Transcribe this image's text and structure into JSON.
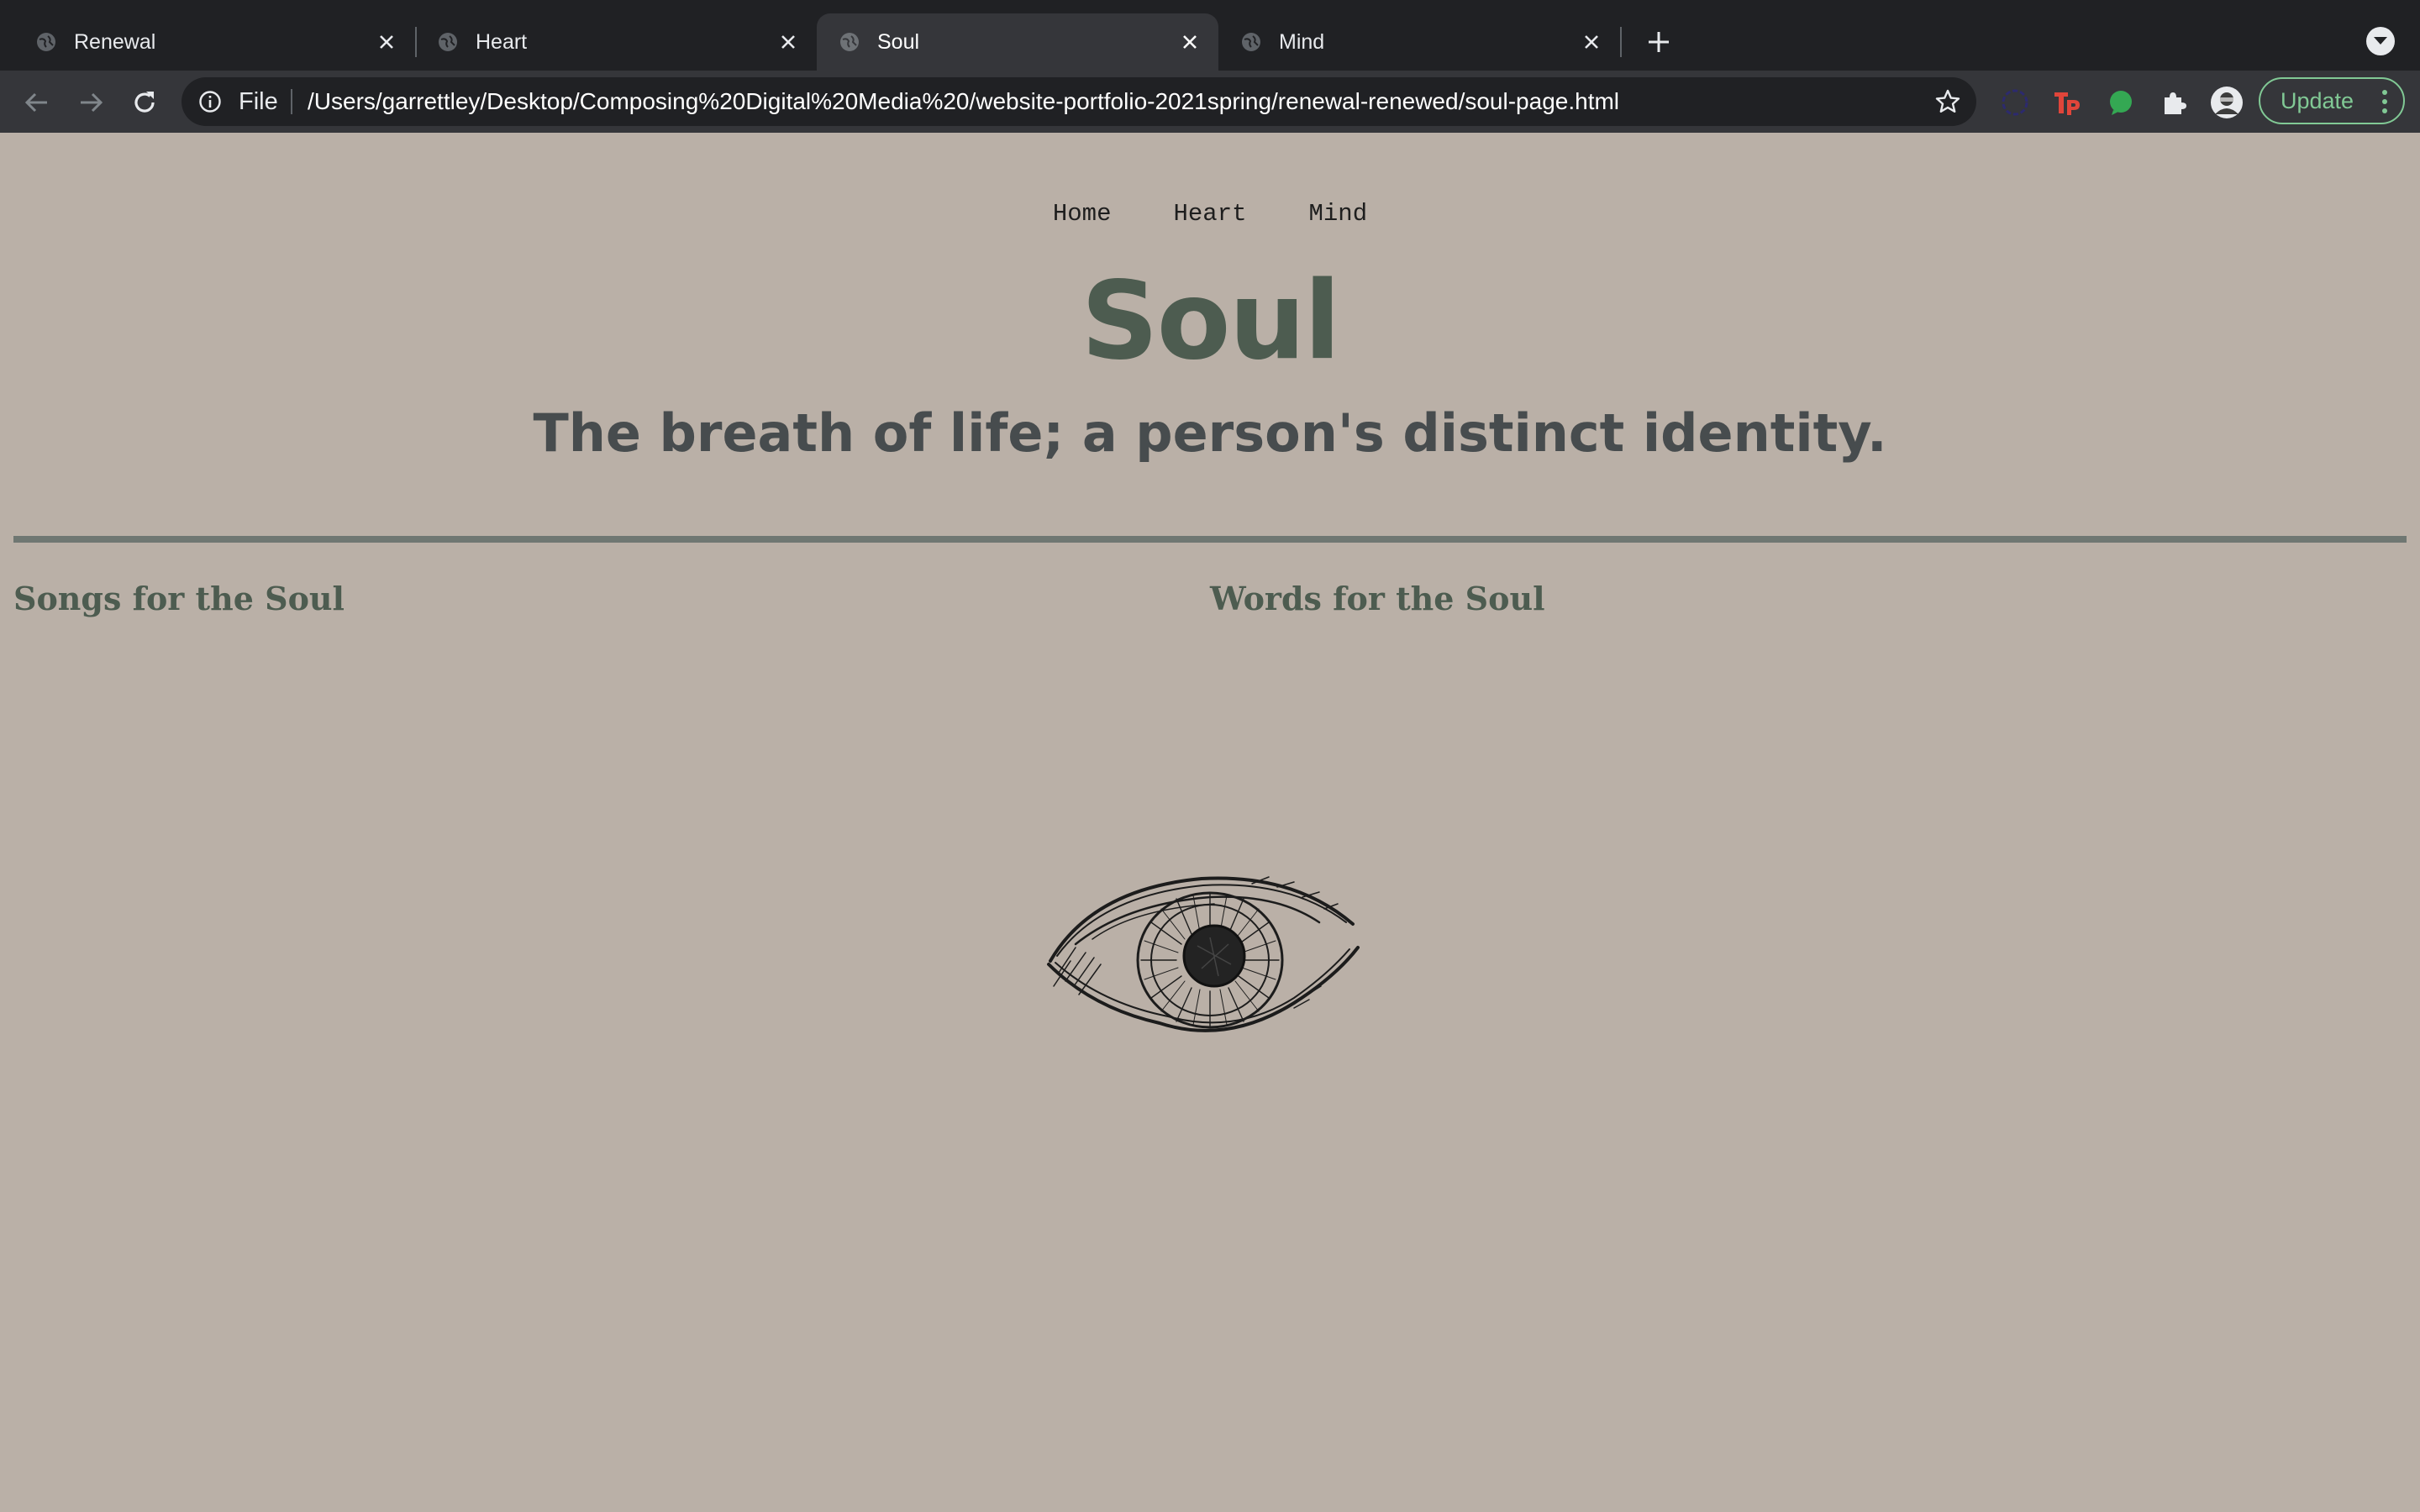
{
  "browser": {
    "tabs": [
      {
        "title": "Renewal",
        "active": false
      },
      {
        "title": "Heart",
        "active": false
      },
      {
        "title": "Soul",
        "active": true
      },
      {
        "title": "Mind",
        "active": false
      }
    ],
    "omnibox": {
      "scheme_label": "File",
      "url": "/Users/garrettley/Desktop/Composing%20Digital%20Media%20/website-portfolio-2021spring/renewal-renewed/soul-page.html"
    },
    "update_label": "Update",
    "colors": {
      "tabstrip": "#202124",
      "toolbar": "#35363a",
      "update_accent": "#81c995"
    }
  },
  "page": {
    "nav": [
      "Home",
      "Heart",
      "Mind"
    ],
    "title": "Soul",
    "subtitle": "The breath of life; a person's distinct identity.",
    "left_heading": "Songs for the Soul",
    "right_heading": "Words for the Soul",
    "image": "eye-sketch",
    "colors": {
      "background": "#bab0a7",
      "title": "#4d5c50",
      "subtitle": "#474c4e",
      "divider": "#6f7772"
    }
  }
}
